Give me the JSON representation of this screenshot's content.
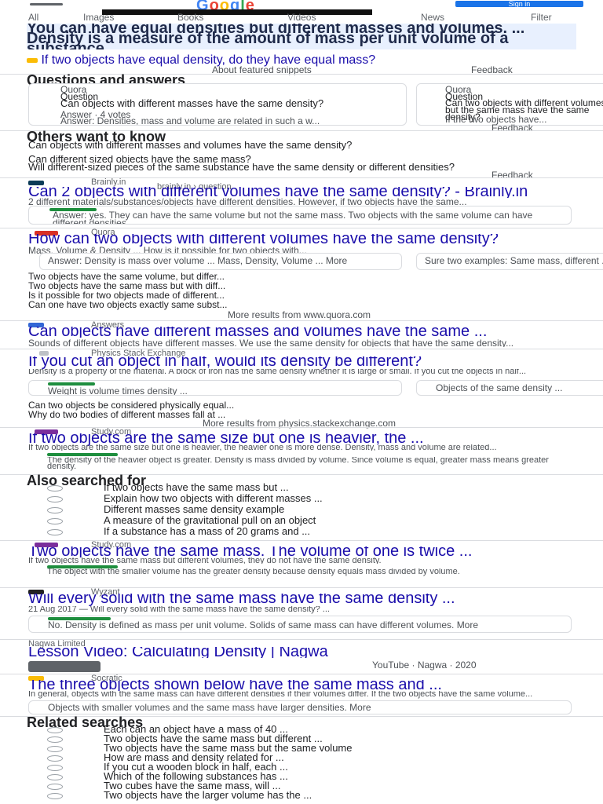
{
  "header": {
    "logo": [
      "G",
      "o",
      "o",
      "g",
      "l",
      "e"
    ],
    "logo_colors": [
      "#4285f4",
      "#ea4335",
      "#fbbc05",
      "#4285f4",
      "#34a853",
      "#ea4335"
    ],
    "sign_in": "Sign in",
    "tabs": [
      "All",
      "Images",
      "Books",
      "Videos",
      "News",
      "Filter"
    ]
  },
  "featured": {
    "text": "You can have equal densities but different masses and volumes. ... Density is a measure of the amount of mass per unit volume of a substance.",
    "link": "If two objects have equal density, do they have equal mass?",
    "about": "About featured snippets",
    "feedback": "Feedback"
  },
  "qa": {
    "title": "Questions and answers",
    "cards": [
      {
        "source": "Quora",
        "q": "Question",
        "body": "Can objects with different masses have the same density?",
        "answer": "Answer · 4 votes",
        "snip": "Answer: Densities, mass and volume are related in such a w...",
        "more": "More"
      },
      {
        "source": "Quora",
        "q": "Question",
        "body": "Can two objects with different volumes but the same mass have the same density?",
        "answer": "",
        "snip": "If the two objects have...",
        "more": "More"
      }
    ],
    "feedback": "Feedback"
  },
  "others": {
    "title": "Others want to know",
    "items": [
      "Can objects with different masses and volumes have the same density?",
      "Can different sized objects have the same mass?",
      "Will different-sized pieces of the same substance have the same density or different densities?"
    ],
    "feedback": "Feedback"
  },
  "results": [
    {
      "site": "Brainly.in",
      "url": "brainly.in › question",
      "title": "Can 2 objects with different volumes have the same density? - Brainly.in",
      "snippet": "2 different materials/substances/objects have different densities. However, if two objects have the same...",
      "badge": "Answer",
      "answer": "Answer: yes. They can have the same volume but not the same mass. Two objects with the same volume can have different densities. ...",
      "more": "More"
    },
    {
      "site": "Quora",
      "url": "www.quora.com › How-can-two-objects...",
      "title": "How can two objects with different volumes have the same density?",
      "snippet": "Mass, Volume & Density ... How is it possible for two objects with...",
      "cards": [
        "Answer: Density is mass over volume ... Mass, Density, Volume ... More",
        "Sure two examples: Same mass, different ..."
      ],
      "rows": [
        "Two objects have the same volume, but differ...",
        "Two objects have the same mass but with diff...",
        "Is it possible for two objects made of different...",
        "Can one have two objects exactly same subst..."
      ],
      "more_results": "More results from www.quora.com"
    },
    {
      "site": "Answers",
      "url": "www.answers.com › Q › Can...",
      "title": "Can objects have different masses and volumes have the same ...",
      "snippet": "Sounds of different objects have different masses. We use the same density for objects that have the same density..."
    },
    {
      "site": "Physics Stack Exchange",
      "url": "physics.stackexchange.com › questions",
      "title": "If you cut an object in half, would its density be different?",
      "snippet": "Density is a property of the material. A block of iron has the same density whether it is large or small. If you cut the objects in half...",
      "cards": [
        "Weight is volume times density ...",
        "Objects of the same density ..."
      ],
      "rows": [
        "Can two objects be considered physically equal...",
        "Why do two bodies of different masses fall at ..."
      ],
      "more_results": "More results from physics.stackexchange.com"
    },
    {
      "site": "Study.com",
      "url": "study.com › academy › answer",
      "title": "If two objects are the same size but one is heavier, the ...",
      "snippet": "If two objects are the same size but one is heavier, the heavier one is more dense. Density, mass and volume are related...",
      "badge": "Top answer",
      "answer": "The density of the heavier object is greater. Density is mass divided by volume. Since volume is equal, greater mass means greater density."
    }
  ],
  "also": {
    "title": "Also searched for",
    "items": [
      "If two objects have the same mass but ...",
      "Explain how two objects with different masses ...",
      "Different masses same density example",
      "A measure of the gravitational pull on an object",
      "If a substance has a mass of 20 grams and ..."
    ]
  },
  "results2": [
    {
      "site": "Study.com",
      "url": "study.com › academy › answer",
      "title": "Two objects have the same mass. The volume of one is twice ...",
      "snippet": "If two objects have the same mass but different volumes, they do not have the same density.",
      "badge": "Top answer",
      "answer": "The object with the smaller volume has the greater density because density equals mass divided by volume."
    },
    {
      "site": "Wyzant",
      "url": "www.wyzant.com › answers",
      "title": "Will every solid with the same mass have the same density ...",
      "snippet": "21 Aug 2017 — Will every solid with the same mass have the same density? ...",
      "badge": "Best answer",
      "answer": "No. Density is defined as mass per unit volume. Solids of same mass can have different volumes. More"
    },
    {
      "site": "Nagwa Limited",
      "url": "www.nagwa.com › videos",
      "title": "Lesson Video: Calculating Density | Nagwa",
      "snippet": "",
      "video_meta": "YouTube · Nagwa · 2020"
    },
    {
      "site": "Socratic",
      "url": "socratic.org › ... › Density",
      "title": "The three objects shown below have the same mass and ...",
      "snippet": "In general, objects with the same mass can have different densities if their volumes differ. If the two objects have the same volume...",
      "answer": "Objects with smaller volumes and the same mass have larger densities. More"
    }
  ],
  "related": {
    "title": "Related searches",
    "items": [
      "Each can an object have a mass of 40 ...",
      "Two objects have the same mass but different ...",
      "Two objects have the same mass but the same volume",
      "How are mass and density related for ...",
      "If you cut a wooden block in half, each ...",
      "Which of the following substances has ...",
      "Two cubes have the same mass, will ...",
      "Two objects have the larger volume has the ..."
    ]
  }
}
